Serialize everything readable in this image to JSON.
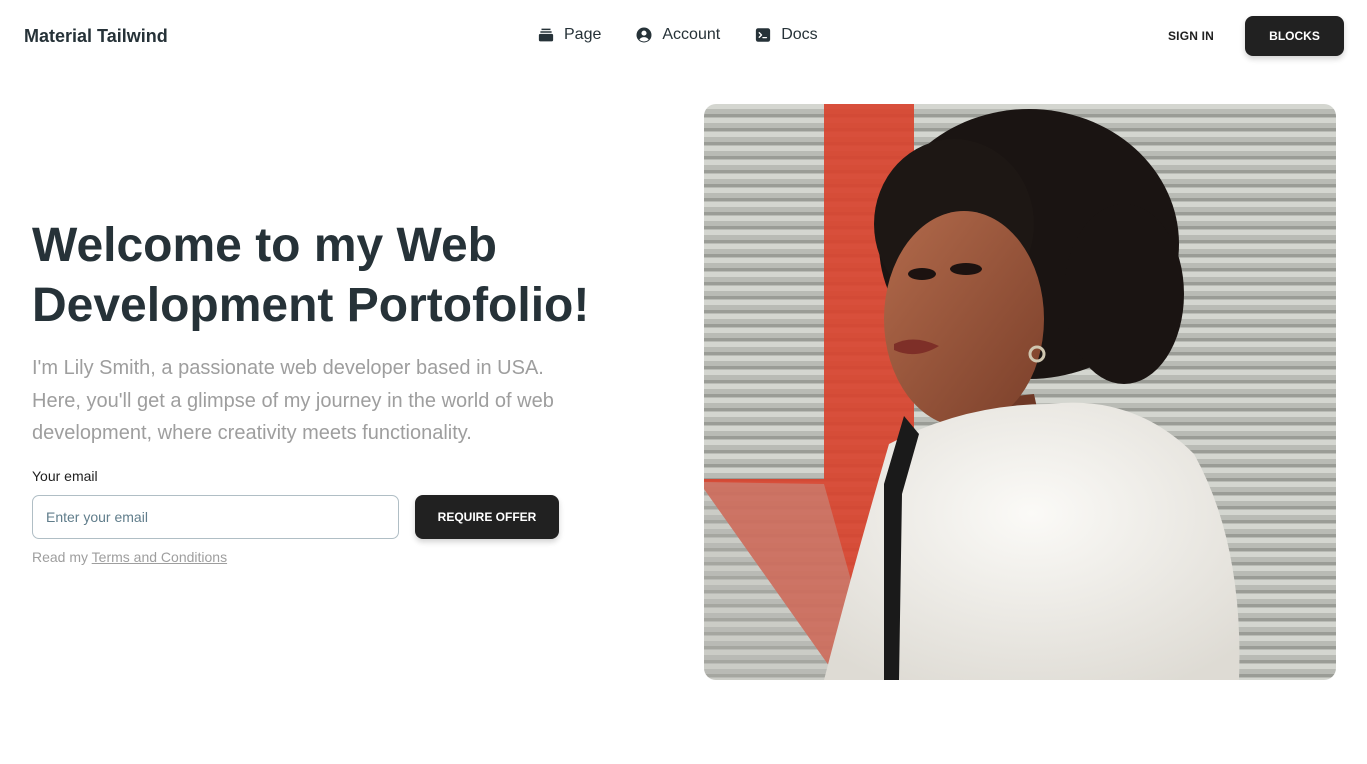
{
  "brand": "Material Tailwind",
  "nav": {
    "items": [
      {
        "label": "Page",
        "icon": "stack-icon"
      },
      {
        "label": "Account",
        "icon": "user-circle-icon"
      },
      {
        "label": "Docs",
        "icon": "terminal-icon"
      }
    ],
    "signin_label": "SIGN IN",
    "blocks_label": "BLOCKS"
  },
  "hero": {
    "title_line1": "Welcome to my Web",
    "title_line2": "Development Portofolio!",
    "description": "I'm Lily Smith, a passionate web developer based in USA. Here, you'll get a glimpse of my journey in the world of web development, where creativity meets functionality.",
    "email_label": "Your email",
    "email_placeholder": "Enter your email",
    "email_value": "",
    "offer_button": "REQUIRE OFFER",
    "terms_prefix": "Read my",
    "terms_link": "Terms and Conditions"
  },
  "colors": {
    "text_dark": "#263238",
    "text_muted": "#9e9e9e",
    "button_dark": "#212121"
  }
}
